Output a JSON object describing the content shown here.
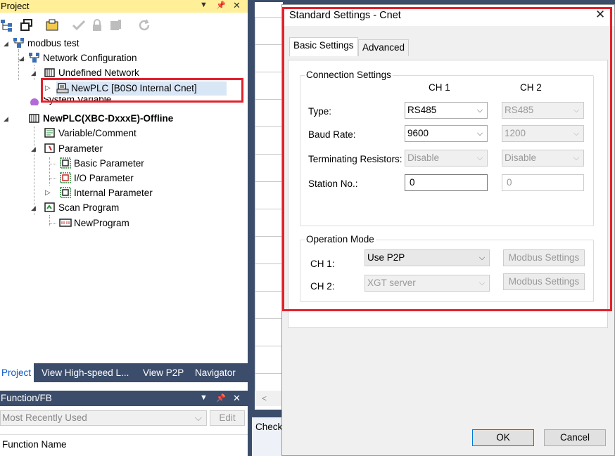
{
  "project_panel": {
    "title": "Project",
    "tree": {
      "root": "modbus test",
      "network_config": "Network Configuration",
      "undefined_network": "Undefined Network",
      "newplc_cnet": "NewPLC [B0S0 Internal Cnet]",
      "system_variable": "System Variable",
      "plc": "NewPLC(XBC-DxxxE)-Offline",
      "variable_comment": "Variable/Comment",
      "parameter": "Parameter",
      "basic_parameter": "Basic Parameter",
      "io_parameter": "I/O Parameter",
      "internal_parameter": "Internal Parameter",
      "scan_program": "Scan Program",
      "new_program": "NewProgram"
    },
    "tabs": [
      "Project",
      "View High-speed L...",
      "View P2P",
      "Navigator"
    ]
  },
  "function_panel": {
    "title": "Function/FB",
    "filter": "Most Recently Used",
    "edit_label": "Edit",
    "column_header": "Function Name"
  },
  "check_panel": {
    "title": "Check"
  },
  "dialog": {
    "title": "Standard Settings - Cnet",
    "close_glyph": "✕",
    "tabs": {
      "basic": "Basic Settings",
      "advanced": "Advanced"
    },
    "connection": {
      "group_label": "Connection Settings",
      "ch1_header": "CH 1",
      "ch2_header": "CH 2",
      "type_label": "Type:",
      "baud_label": "Baud Rate:",
      "term_label": "Terminating Resistors:",
      "station_label": "Station No.:",
      "ch1": {
        "type": "RS485",
        "baud": "9600",
        "term": "Disable",
        "station": "0"
      },
      "ch2": {
        "type": "RS485",
        "baud": "1200",
        "term": "Disable",
        "station": "0"
      }
    },
    "operation": {
      "group_label": "Operation Mode",
      "ch1_label": "CH 1:",
      "ch2_label": "CH 2:",
      "ch1_mode": "Use P2P",
      "ch2_mode": "XGT server",
      "modbus_label": "Modbus Settings"
    },
    "ok_label": "OK",
    "cancel_label": "Cancel"
  },
  "colors": {
    "highlight": "#e3212b",
    "panel_dark": "#3c4d6b",
    "titlebar_yellow": "#ffef98",
    "active_tab_text": "#0b59c9"
  }
}
